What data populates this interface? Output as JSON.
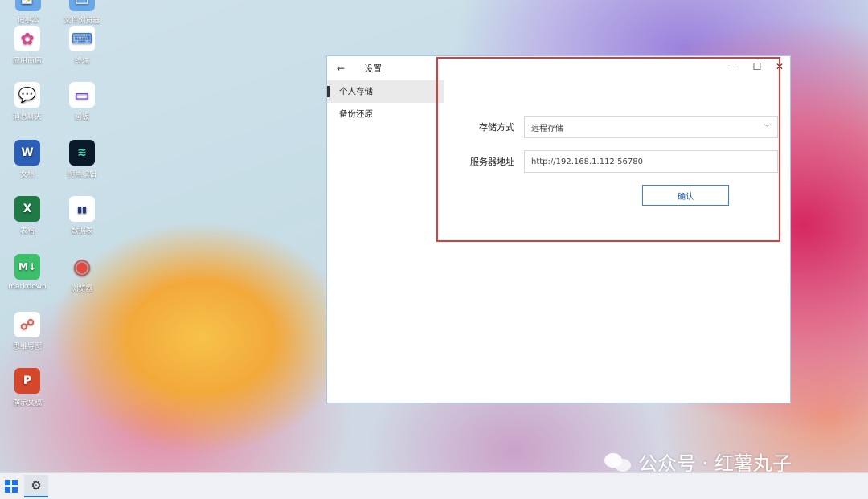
{
  "desktop": {
    "icons": [
      {
        "label": "记事本",
        "glyph": "📝",
        "bg": "#6aa7e8"
      },
      {
        "label": "文件浏览器",
        "glyph": "🗂",
        "bg": "#6aa7e8"
      },
      {
        "label": "应用商店",
        "glyph": "✿",
        "bg": "#ffffff",
        "color": "#e0408d"
      },
      {
        "label": "终端",
        "glyph": "⌨",
        "bg": "#ffffff",
        "color": "#2a7ae2"
      },
      {
        "label": "消息聊天",
        "glyph": "💬",
        "bg": "#ffffff",
        "color": "#1d6bd8"
      },
      {
        "label": "画板",
        "glyph": "▭",
        "bg": "#ffffff",
        "color": "#7b3fe4"
      },
      {
        "label": "文档",
        "glyph": "W",
        "bg": "#2b5fb6",
        "color": "#ffffff"
      },
      {
        "label": "图片编辑",
        "glyph": "≋",
        "bg": "#0a1a2a",
        "color": "#3fe0c0"
      },
      {
        "label": "表格",
        "glyph": "X",
        "bg": "#1f7a45",
        "color": "#ffffff"
      },
      {
        "label": "数据表",
        "glyph": "▮▮",
        "bg": "#ffffff",
        "color": "#243a7a"
      },
      {
        "label": "markdown",
        "glyph": "M↓",
        "bg": "#3cbf6a",
        "color": "#ffffff"
      },
      {
        "label": "浏览器",
        "glyph": "◉",
        "bg": "#ffffff",
        "color": "#e8453c"
      },
      {
        "label": "思维导图",
        "glyph": "☍",
        "bg": "#ffffff",
        "color": "#e64a3b"
      },
      {
        "label": "演示文稿",
        "glyph": "P",
        "bg": "#d4472a",
        "color": "#ffffff"
      }
    ]
  },
  "window": {
    "back_glyph": "←",
    "title": "设置",
    "controls": {
      "minimize": "—",
      "maximize": "☐",
      "close": "✕"
    },
    "sidebar": [
      {
        "label": "个人存储",
        "active": true
      },
      {
        "label": "备份还原",
        "active": false
      }
    ],
    "form": {
      "storage_label": "存储方式",
      "storage_value": "远程存储",
      "server_label": "服务器地址",
      "server_value": "http://192.168.1.112:56780",
      "confirm_label": "确认"
    }
  },
  "taskbar": {
    "gear_glyph": "⚙"
  },
  "watermark": {
    "text": "公众号 · 红薯丸子"
  },
  "colors": {
    "highlight": "#e53935",
    "accent": "#1a73e8"
  }
}
